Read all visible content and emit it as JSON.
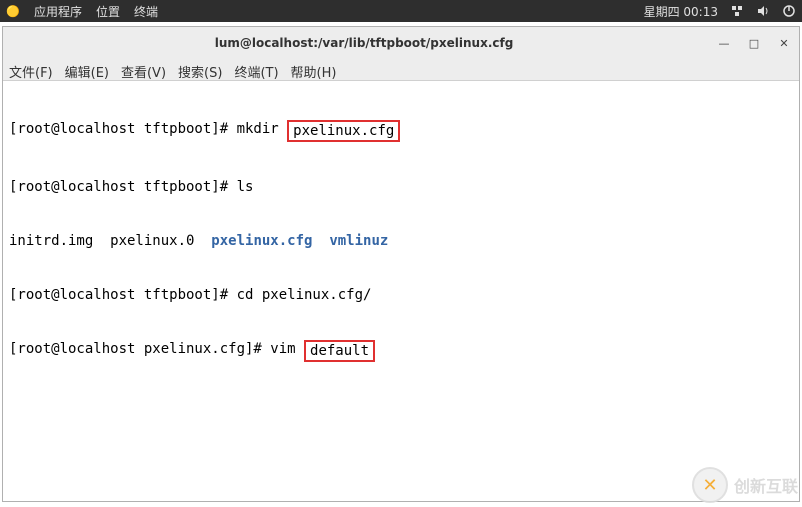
{
  "top_panel": {
    "apps_label": "应用程序",
    "places_label": "位置",
    "terminal_label": "终端",
    "clock": "星期四 00:13"
  },
  "window": {
    "title": "lum@localhost:/var/lib/tftpboot/pxelinux.cfg"
  },
  "menubar": {
    "file": "文件(F)",
    "edit": "编辑(E)",
    "view": "查看(V)",
    "search": "搜索(S)",
    "terminal": "终端(T)",
    "help": "帮助(H)"
  },
  "terminal": {
    "line1_prefix": "[root@localhost tftpboot]# mkdir ",
    "line1_box": "pxelinux.cfg",
    "line2": "[root@localhost tftpboot]# ls",
    "line3_a": "initrd.img  pxelinux.0  ",
    "line3_b": "pxelinux.cfg",
    "line3_c": "  ",
    "line3_d": "vmlinuz",
    "line4": "[root@localhost tftpboot]# cd pxelinux.cfg/",
    "line5_prefix": "[root@localhost pxelinux.cfg]# vim ",
    "line5_box": "default"
  },
  "watermark": {
    "text": "创新互联"
  }
}
